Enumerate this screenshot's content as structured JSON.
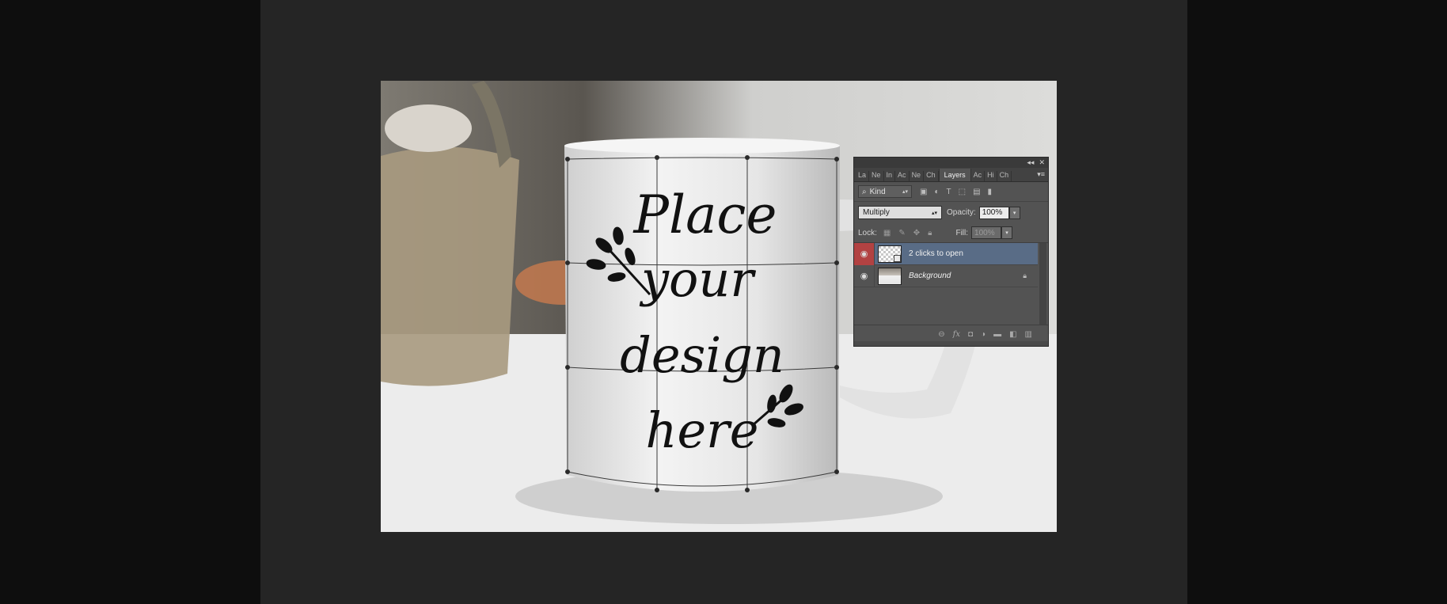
{
  "panel": {
    "tabs": [
      "La",
      "Ne",
      "In",
      "Ac",
      "Ne",
      "Ch",
      "Layers",
      "Ac",
      "Hi",
      "Ch"
    ],
    "active_tab": "Layers",
    "filter_kind": "Kind",
    "blend_mode": "Multiply",
    "opacity_label": "Opacity:",
    "opacity_value": "100%",
    "lock_label": "Lock:",
    "fill_label": "Fill:",
    "fill_value": "100%",
    "layers": [
      {
        "name": "2 clicks to open",
        "selected": true
      },
      {
        "name": "Background",
        "selected": false
      }
    ]
  },
  "mockup_text": {
    "line1": "Place",
    "line2": "your",
    "line3": "design",
    "line4": "here"
  }
}
